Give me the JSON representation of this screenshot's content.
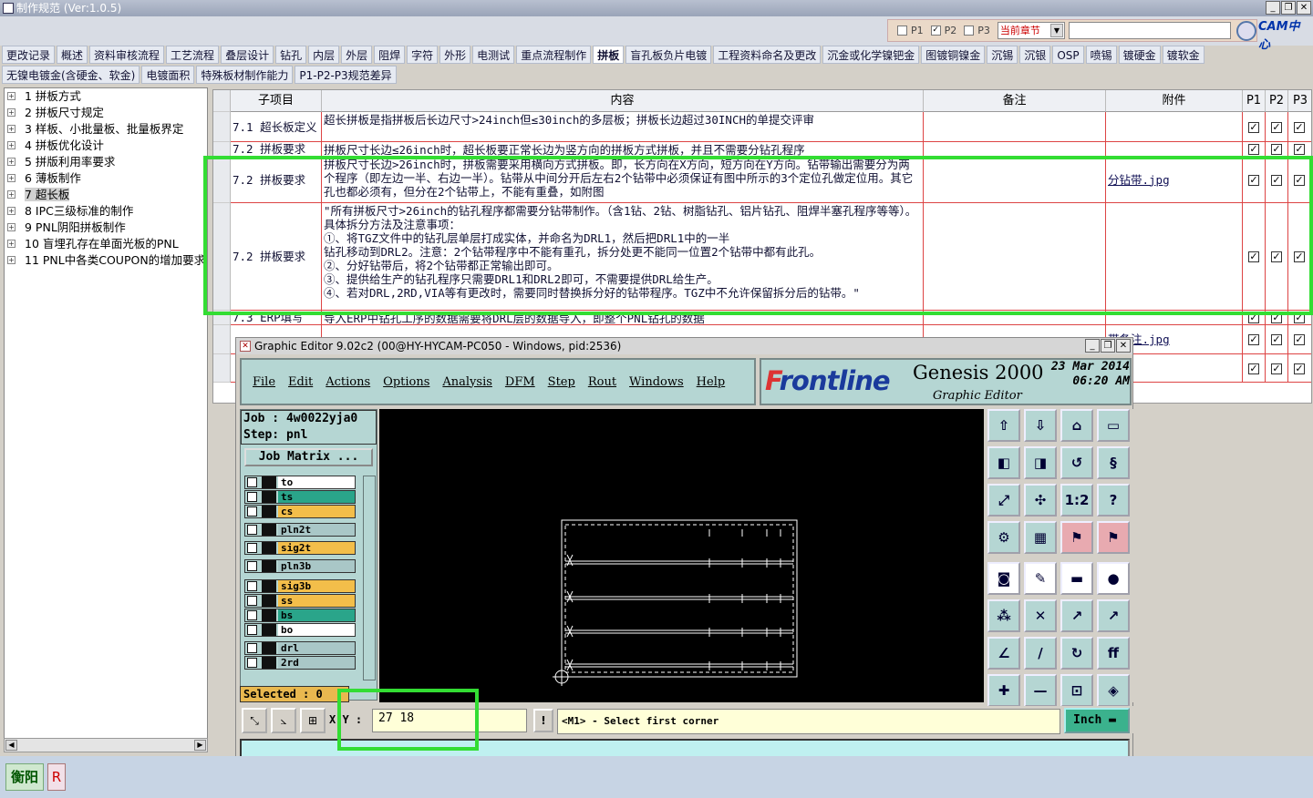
{
  "window": {
    "title": "制作规范 (Ver:1.0.5)"
  },
  "toolbar": {
    "p1": "P1",
    "p2": "P2",
    "p3": "P3",
    "chapter": "当前章节",
    "cam_logo": "CAM中心"
  },
  "tabs_row1": [
    "更改记录",
    "概述",
    "资料审核流程",
    "工艺流程",
    "叠层设计",
    "钻孔",
    "内层",
    "外层",
    "阻焊",
    "字符",
    "外形",
    "电测试",
    "重点流程制作",
    "拼板",
    "盲孔板负片电镀",
    "工程资料命名及更改",
    "沉金或化学镍钯金",
    "图镀铜镍金",
    "沉锡",
    "沉银",
    "OSP",
    "喷锡",
    "镀硬金",
    "镀软金"
  ],
  "active_tab": "拼板",
  "tabs_row2": [
    "无镍电镀金(含硬金、软金)",
    "电镀面积",
    "特殊板材制作能力",
    "P1-P2-P3规范差异"
  ],
  "tree": [
    {
      "label": "1 拼板方式",
      "selected": false
    },
    {
      "label": "2 拼板尺寸规定",
      "selected": false
    },
    {
      "label": "3 样板、小批量板、批量板界定",
      "selected": false
    },
    {
      "label": "4 拼板优化设计",
      "selected": false
    },
    {
      "label": "5 拼版利用率要求",
      "selected": false
    },
    {
      "label": "6 薄板制作",
      "selected": false
    },
    {
      "label": "7 超长板",
      "selected": true
    },
    {
      "label": "8 IPC三级标准的制作",
      "selected": false
    },
    {
      "label": "9 PNL阴阳拼板制作",
      "selected": false
    },
    {
      "label": "10 盲埋孔存在单面光板的PNL",
      "selected": false
    },
    {
      "label": "11 PNL中各类COUPON的增加要求",
      "selected": false
    }
  ],
  "grid": {
    "headers": {
      "item": "子项目",
      "content": "内容",
      "remark": "备注",
      "attach": "附件",
      "p1": "P1",
      "p2": "P2",
      "p3": "P3"
    },
    "rows": [
      {
        "item": "7.1 超长板定义",
        "content": "超长拼板是指拼板后长边尺寸>24inch但≤30inch的多层板；拼板长边超过30INCH的单提交评审",
        "attach": ""
      },
      {
        "item": "7.2 拼板要求",
        "content": "拼板尺寸长边≤26inch时，超长板要正常长边为竖方向的拼板方式拼板，并且不需要分钻孔程序",
        "attach": ""
      },
      {
        "item": "7.2 拼板要求",
        "content": "拼板尺寸长边>26inch时，拼板需要采用横向方式拼板。即，长方向在X方向，短方向在Y方向。钻带输出需要分为两个程序（即左边一半、右边一半）。钻带从中间分开后左右2个钻带中必须保证有图中所示的3个定位孔做定位用。其它孔也都必须有，但分在2个钻带上，不能有重叠，如附图",
        "attach": "分钻带.jpg"
      },
      {
        "item": "7.2 拼板要求",
        "content": "\"所有拼板尺寸>26inch的钻孔程序都需要分钻带制作。（含1钻、2钻、树脂钻孔、铝片钻孔、阻焊半塞孔程序等等）。具体拆分方法及注意事项：\n①、将TGZ文件中的钻孔层单层打成实体，并命名为DRL1，然后把DRL1中的一半\n钻孔移动到DRL2。注意：2个钻带程序中不能有重孔，拆分处更不能同一位置2个钻带中都有此孔。\n②、分好钻带后，将2个钻带都正常输出即可。\n③、提供给生产的钻孔程序只需要DRL1和DRL2即可，不需要提供DRL给生产。\n④、若对DRL,2RD,VIA等有更改时，需要同时替换拆分好的钻带程序。TGZ中不允许保留拆分后的钻带。\"",
        "attach": ""
      },
      {
        "item": "7.3 ERP填写",
        "content": "导入ERP中钻孔工序的数据需要将DRL层的数据导入，即整个PNL钻孔的数据",
        "attach": ""
      },
      {
        "item": "",
        "content": "",
        "attach": "带备注.jpg"
      },
      {
        "item": "",
        "content": "",
        "attach": ""
      }
    ]
  },
  "editor": {
    "title": "Graphic Editor 9.02c2 (00@HY-HYCAM-PC050 - Windows, pid:2536)",
    "menu": [
      "File",
      "Edit",
      "Actions",
      "Options",
      "Analysis",
      "DFM",
      "Step",
      "Rout",
      "Windows",
      "Help"
    ],
    "brand": {
      "logo_pre": "F",
      "logo_post": "rontline",
      "product": "Genesis 2000",
      "sub": "Graphic Editor",
      "date": "23 Mar 2014",
      "time": "06:20 AM"
    },
    "job": "Job : 4w0022yja0",
    "step": "Step: pnl",
    "job_matrix": "Job Matrix ...",
    "layers": [
      {
        "name": "to",
        "color": "#ffffff"
      },
      {
        "name": "ts",
        "color": "#2aa58a"
      },
      {
        "name": "cs",
        "color": "#f3be4a"
      },
      {
        "name": "pln2t",
        "color": "#a9c7c7"
      },
      {
        "name": "sig2t",
        "color": "#f3be4a"
      },
      {
        "name": "pln3b",
        "color": "#a9c7c7"
      },
      {
        "name": "sig3b",
        "color": "#f3be4a"
      },
      {
        "name": "ss",
        "color": "#f3be4a"
      },
      {
        "name": "bs",
        "color": "#2aa58a"
      },
      {
        "name": "bo",
        "color": "#ffffff"
      },
      {
        "name": "drl",
        "color": "#a9c7c7"
      },
      {
        "name": "2rd",
        "color": "#a9c7c7"
      }
    ],
    "selected": "Selected : 0",
    "xy_label": "X Y :",
    "xy_value": "27 18",
    "message": "<M1> - Select first corner",
    "units": "Inch"
  },
  "statusbar": {
    "city": "衡阳",
    "r": "R"
  }
}
